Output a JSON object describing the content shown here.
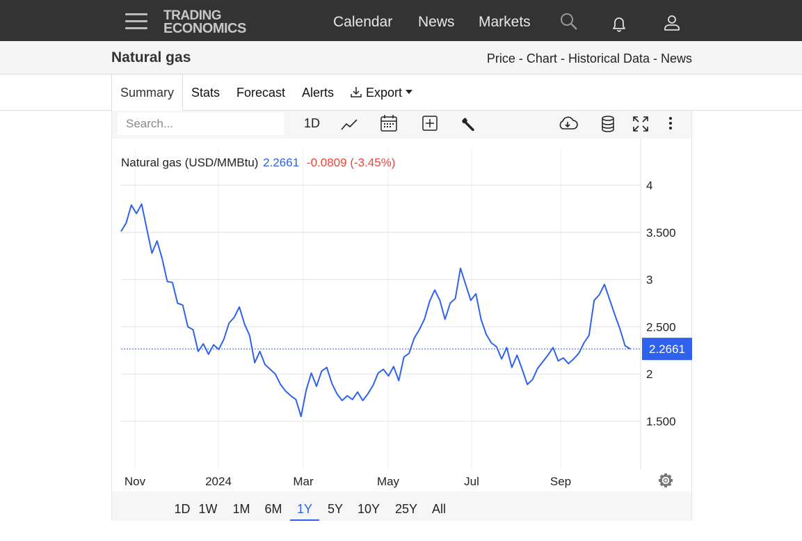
{
  "header": {
    "logo_line1": "TRADING",
    "logo_line2": "ECONOMICS",
    "nav": [
      "Calendar",
      "News",
      "Markets"
    ],
    "icons": [
      "menu-icon",
      "search-icon",
      "bell-icon",
      "user-icon"
    ]
  },
  "subheader": {
    "title": "Natural gas",
    "crumbs": [
      "Price",
      "Chart",
      "Historical Data",
      "News"
    ],
    "separator": " - "
  },
  "tabs": [
    "Summary",
    "Stats",
    "Forecast",
    "Alerts",
    "Export"
  ],
  "toolbar": {
    "search_placeholder": "Search...",
    "interval": "1D",
    "icons": [
      "line-chart-icon",
      "calendar-icon",
      "add-indicator-icon",
      "wrench-icon",
      "cloud-download-icon",
      "database-icon",
      "fullscreen-icon",
      "more-icon"
    ]
  },
  "legend": {
    "name": "Natural gas (USD/MMBtu)",
    "price": "2.2661",
    "change": "-0.0809 (-3.45%)"
  },
  "colors": {
    "line": "#2f62ec",
    "down": "#e8463c",
    "topbar": "#333333"
  },
  "chart_data": {
    "type": "line",
    "title": "",
    "ylim": [
      1.2,
      4.2
    ],
    "y_ticks": [
      {
        "value": 4,
        "label": "4"
      },
      {
        "value": 3.5,
        "label": "3.500"
      },
      {
        "value": 3,
        "label": "3"
      },
      {
        "value": 2.5,
        "label": "2.500"
      },
      {
        "value": 2,
        "label": "2"
      },
      {
        "value": 1.5,
        "label": "1.500"
      }
    ],
    "x_ticks": [
      "Nov",
      "2024",
      "Mar",
      "May",
      "Jul",
      "Sep"
    ],
    "last_value": 2.2661,
    "last_label": "2.2661",
    "grid": true,
    "series": [
      {
        "values": [
          3.51,
          3.6,
          3.79,
          3.7,
          3.8,
          3.54,
          3.28,
          3.41,
          3.22,
          2.98,
          2.97,
          2.75,
          2.73,
          2.5,
          2.47,
          2.24,
          2.32,
          2.21,
          2.31,
          2.26,
          2.37,
          2.54,
          2.6,
          2.71,
          2.53,
          2.41,
          2.12,
          2.24,
          2.1,
          2.05,
          2.0,
          1.89,
          1.82,
          1.77,
          1.73,
          1.55,
          1.83,
          2.01,
          1.87,
          2.03,
          2.07,
          1.9,
          1.79,
          1.72,
          1.77,
          1.73,
          1.81,
          1.72,
          1.79,
          1.88,
          2.01,
          2.05,
          1.98,
          2.08,
          1.93,
          2.18,
          2.22,
          2.38,
          2.47,
          2.58,
          2.77,
          2.89,
          2.78,
          2.58,
          2.75,
          2.8,
          3.12,
          2.95,
          2.78,
          2.85,
          2.58,
          2.42,
          2.33,
          2.29,
          2.16,
          2.28,
          2.07,
          2.2,
          2.05,
          1.89,
          1.94,
          2.06,
          2.13,
          2.2,
          2.28,
          2.14,
          2.17,
          2.11,
          2.16,
          2.22,
          2.33,
          2.41,
          2.78,
          2.84,
          2.95,
          2.79,
          2.63,
          2.48,
          2.3,
          2.2661
        ]
      }
    ]
  },
  "ranges": [
    "1D",
    "1W",
    "1M",
    "6M",
    "1Y",
    "5Y",
    "10Y",
    "25Y",
    "All"
  ],
  "active_range": "1Y"
}
